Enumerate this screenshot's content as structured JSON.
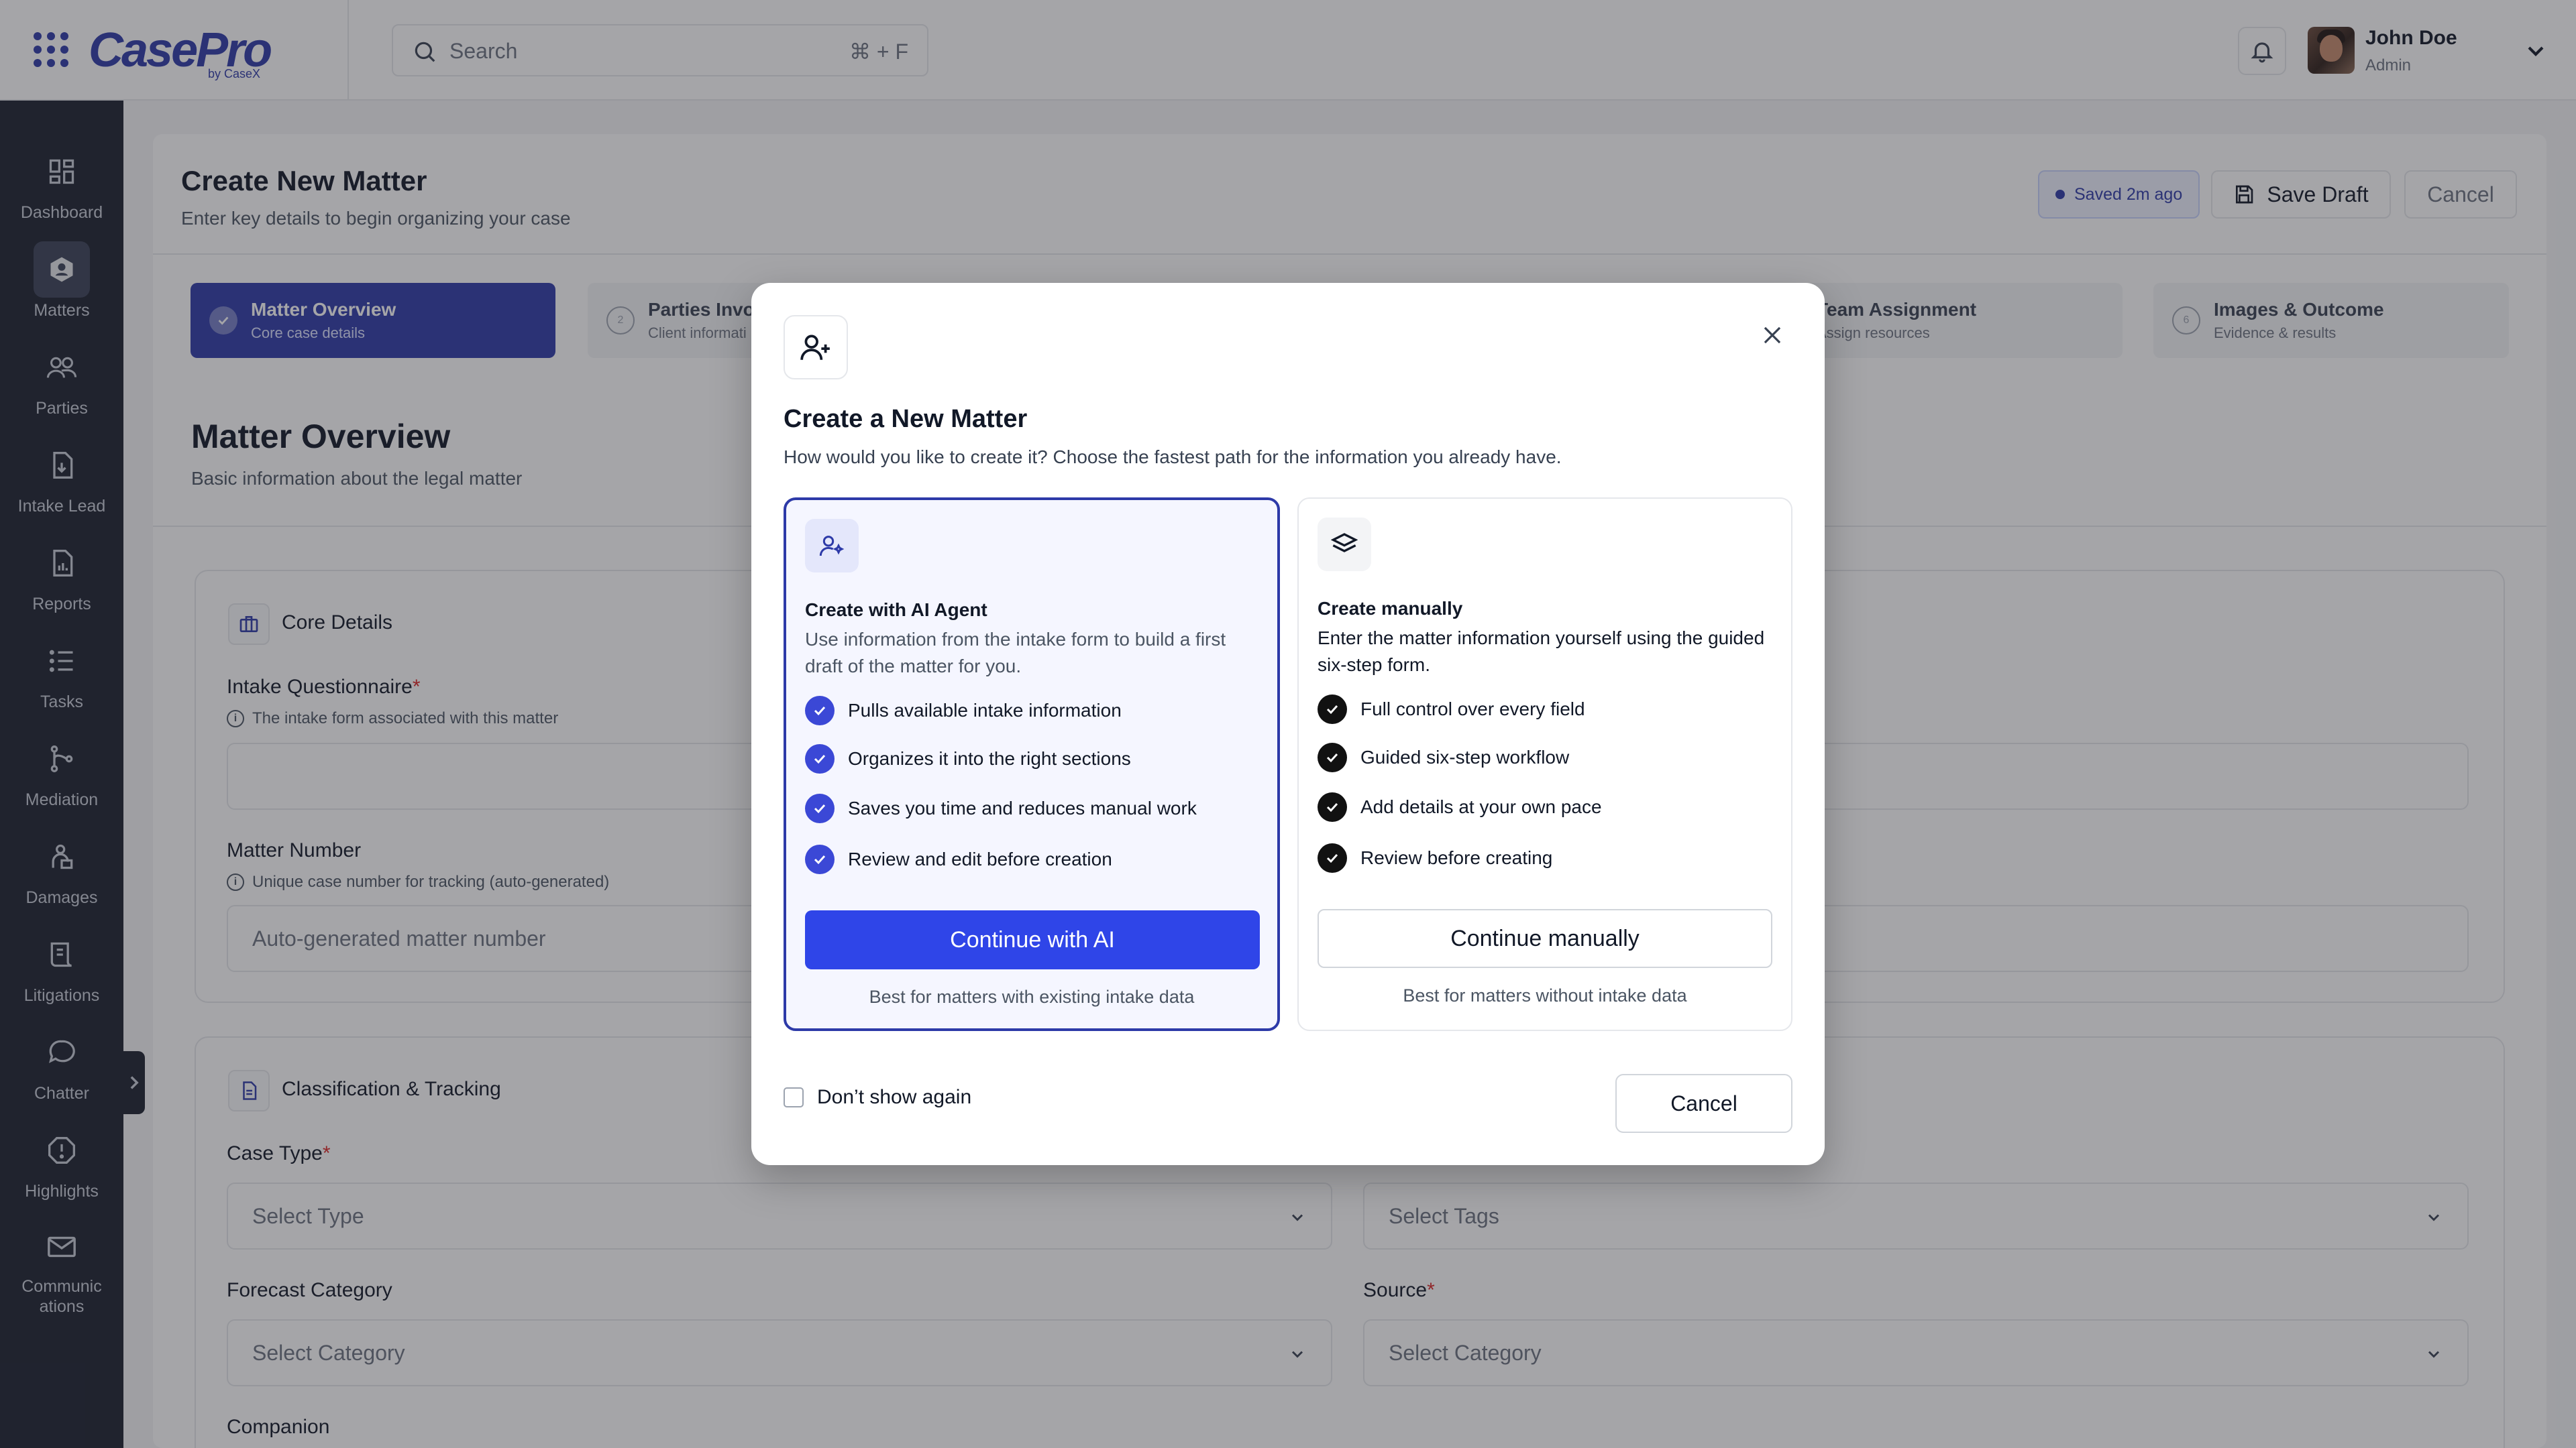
{
  "app": {
    "logo": "CasePro",
    "logo_sub": "by CaseX",
    "search_placeholder": "Search",
    "search_shortcut": "⌘ + F",
    "user": {
      "name": "John Doe",
      "role": "Admin"
    }
  },
  "sidebar": {
    "items": [
      {
        "label": "Dashboard",
        "icon": "dashboard-icon"
      },
      {
        "label": "Matters",
        "icon": "matters-icon"
      },
      {
        "label": "Parties",
        "icon": "parties-icon"
      },
      {
        "label": "Intake Lead",
        "icon": "intake-lead-icon"
      },
      {
        "label": "Reports",
        "icon": "reports-icon"
      },
      {
        "label": "Tasks",
        "icon": "tasks-icon"
      },
      {
        "label": "Mediation",
        "icon": "mediation-icon"
      },
      {
        "label": "Damages",
        "icon": "damages-icon"
      },
      {
        "label": "Litigations",
        "icon": "litigations-icon"
      },
      {
        "label": "Chatter",
        "icon": "chatter-icon"
      },
      {
        "label": "Highlights",
        "icon": "highlights-icon"
      },
      {
        "label": "Communications",
        "label_line1": "Communic",
        "label_line2": "ations",
        "icon": "mail-icon"
      }
    ],
    "active": "Matters"
  },
  "page": {
    "title": "Create New Matter",
    "subtitle": "Enter key details to begin organizing your case",
    "saved_label": "Saved 2m ago",
    "save_draft_label": "Save Draft",
    "cancel_label": "Cancel"
  },
  "steps": [
    {
      "num": "",
      "title": "Matter Overview",
      "sub": "Core case details",
      "active": true
    },
    {
      "num": "2",
      "title": "Parties Invol",
      "sub": "Client informati",
      "active": false
    },
    {
      "num": "",
      "title": "Team Assignment",
      "sub": "Assign resources",
      "active": false
    },
    {
      "num": "6",
      "title": "Images & Outcome",
      "sub": "Evidence & results",
      "active": false
    }
  ],
  "section": {
    "title": "Matter Overview",
    "subtitle": "Basic information about the legal matter"
  },
  "core_details": {
    "title": "Core Details",
    "intake_label": "Intake Questionnaire",
    "intake_hint": "The intake form associated with this matter",
    "matter_number_label": "Matter Number",
    "matter_number_hint": "Unique case number for tracking (auto-generated)",
    "matter_number_placeholder": "Auto-generated matter number"
  },
  "classification": {
    "title": "Classification & Tracking",
    "case_type_label": "Case Type",
    "case_type_placeholder": "Select Type",
    "tags_placeholder": "Select Tags",
    "forecast_label": "Forecast Category",
    "forecast_placeholder": "Select Category",
    "source_label": "Source",
    "source_placeholder": "Select Category",
    "companion_label": "Companion"
  },
  "modal": {
    "title": "Create a New Matter",
    "subtitle": "How would you like to create it? Choose the fastest path for the information you already have.",
    "ai": {
      "title": "Create with AI Agent",
      "desc": "Use information from the intake form to build a first draft of the matter for you.",
      "features": [
        "Pulls available intake information",
        "Organizes it into the right sections",
        "Saves you time and reduces manual work",
        "Review and edit before creation"
      ],
      "button": "Continue with AI",
      "note": "Best for matters with existing intake data"
    },
    "manual": {
      "title": "Create manually",
      "desc": "Enter the matter information yourself using the guided six-step form.",
      "features": [
        "Full control over every field",
        "Guided six-step workflow",
        "Add details at your own pace",
        "Review before creating"
      ],
      "button": "Continue manually",
      "note": "Best for matters without intake data"
    },
    "dont_show_label": "Don’t show again",
    "dont_show_checked": false,
    "cancel_label": "Cancel"
  },
  "colors": {
    "brand": "#2d3aa8",
    "primary_button": "#2f45e8",
    "sidebar_bg": "#1a1f2e",
    "required": "#dc2626"
  }
}
